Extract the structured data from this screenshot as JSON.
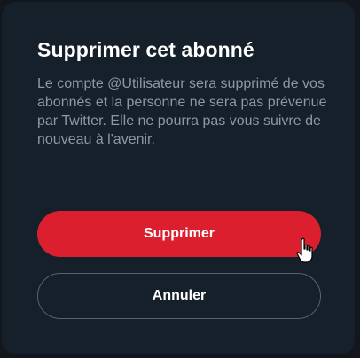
{
  "dialog": {
    "title": "Supprimer cet abonné",
    "message": "Le compte @Utilisateur sera supprimé de vos abonnés et la personne ne sera pas prévenue par Twitter. Elle ne pourra pas vous suivre de nouveau à l'avenir.",
    "confirm_label": "Supprimer",
    "cancel_label": "Annuler"
  },
  "colors": {
    "background": "#15202b",
    "danger": "#dc1f2e",
    "text_primary": "#ffffff",
    "text_secondary": "#8b98a5",
    "border": "#536471"
  },
  "icons": {
    "cursor": "hand-pointer-cursor-icon"
  }
}
